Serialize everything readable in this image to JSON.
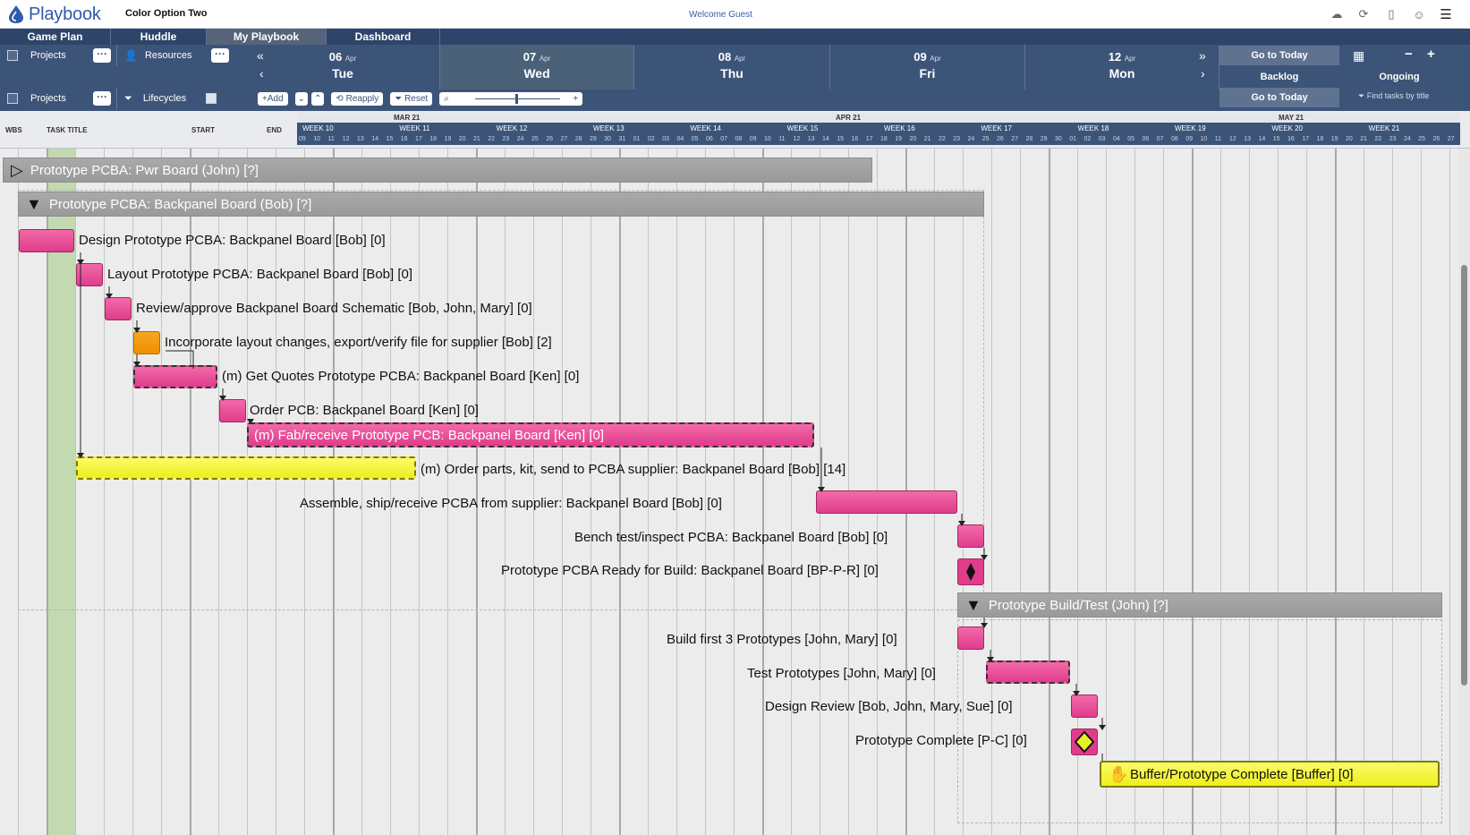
{
  "app": {
    "name": "Playbook",
    "company": "Color Option Two",
    "welcome": "Welcome Guest"
  },
  "tabs": [
    "Game Plan",
    "Huddle",
    "My Playbook",
    "Dashboard"
  ],
  "controls": {
    "projects_label": "Projects",
    "resources_label": "Resources",
    "projects2_label": "Projects",
    "lifecycles_label": "Lifecycles",
    "add": "+Add",
    "reapply": "Reapply",
    "reset": "Reset",
    "go_today_top": "Go to Today",
    "backlog": "Backlog",
    "ongoing": "Ongoing",
    "go_today_bottom": "Go to Today",
    "find_placeholder": "Find tasks by title",
    "prev_fast": "«",
    "prev": "‹",
    "next_fast": "»",
    "next": "›"
  },
  "days": [
    {
      "num": "06",
      "mon": "Apr",
      "name": "Tue"
    },
    {
      "num": "07",
      "mon": "Apr",
      "name": "Wed"
    },
    {
      "num": "08",
      "mon": "Apr",
      "name": "Thu"
    },
    {
      "num": "09",
      "mon": "Apr",
      "name": "Fri"
    },
    {
      "num": "12",
      "mon": "Apr",
      "name": "Mon"
    }
  ],
  "timeline": {
    "col_wbs": "WBS",
    "col_title": "TASK TITLE",
    "col_start": "START",
    "col_end": "END",
    "months": [
      "MAR 21",
      "APR 21",
      "MAY 21"
    ],
    "weeks": [
      "WEEK 10",
      "WEEK 11",
      "WEEK 12",
      "WEEK 13",
      "WEEK 14",
      "WEEK 15",
      "WEEK 16",
      "WEEK 17",
      "WEEK 18",
      "WEEK 19",
      "WEEK 20",
      "WEEK 21"
    ],
    "daynums": [
      "09",
      "10",
      "11",
      "12",
      "13",
      "14",
      "15",
      "16",
      "17",
      "18",
      "19",
      "20",
      "21",
      "22",
      "23",
      "24",
      "25",
      "26",
      "27",
      "28",
      "29",
      "30",
      "31",
      "01",
      "02",
      "03",
      "04",
      "05",
      "06",
      "07",
      "08",
      "09",
      "10",
      "11",
      "12",
      "13",
      "14",
      "15",
      "16",
      "17",
      "18",
      "19",
      "20",
      "21",
      "22",
      "23",
      "24",
      "25",
      "26",
      "27",
      "28",
      "29",
      "30",
      "01",
      "02",
      "03",
      "04",
      "05",
      "06",
      "07",
      "08",
      "09",
      "10",
      "11",
      "12",
      "13",
      "14",
      "15",
      "16",
      "17",
      "18",
      "19",
      "20",
      "21",
      "22",
      "23",
      "24",
      "25",
      "26",
      "27"
    ]
  },
  "tasks": {
    "grp1": "Prototype PCBA: Pwr Board (John) [?]",
    "grp2": "Prototype PCBA: Backpanel Board (Bob) [?]",
    "t1": "Design Prototype PCBA: Backpanel Board [Bob] [0]",
    "t2": "Layout Prototype PCBA: Backpanel Board [Bob] [0]",
    "t3": "Review/approve Backpanel Board Schematic [Bob, John, Mary] [0]",
    "t4": "Incorporate layout changes, export/verify file for supplier [Bob] [2]",
    "t5": "(m) Get Quotes Prototype PCBA: Backpanel Board [Ken] [0]",
    "t6": "Order PCB: Backpanel Board [Ken] [0]",
    "t7": "(m) Fab/receive Prototype PCB: Backpanel Board [Ken] [0]",
    "t8": "(m) Order parts, kit, send to PCBA supplier: Backpanel Board [Bob] [14]",
    "t9": "Assemble, ship/receive PCBA from supplier: Backpanel Board [Bob] [0]",
    "t10": "Bench test/inspect PCBA: Backpanel Board [Bob] [0]",
    "t11": "Prototype PCBA Ready for Build: Backpanel Board [BP-P-R] [0]",
    "grp3": "Prototype Build/Test (John) [?]",
    "t12": "Build first 3 Prototypes [John, Mary] [0]",
    "t13": "Test Prototypes [John, Mary] [0]",
    "t14": "Design Review [Bob, John, Mary, Sue] [0]",
    "t15": "Prototype Complete [P-C] [0]",
    "t16": "Buffer/Prototype Complete [Buffer] [0]"
  },
  "colors": {
    "bar_pink": "#e03c8c",
    "bar_orange": "#ef9000",
    "bar_yellow": "#eeee1c",
    "header": "#3d5479",
    "today": "#b9d6a3"
  }
}
